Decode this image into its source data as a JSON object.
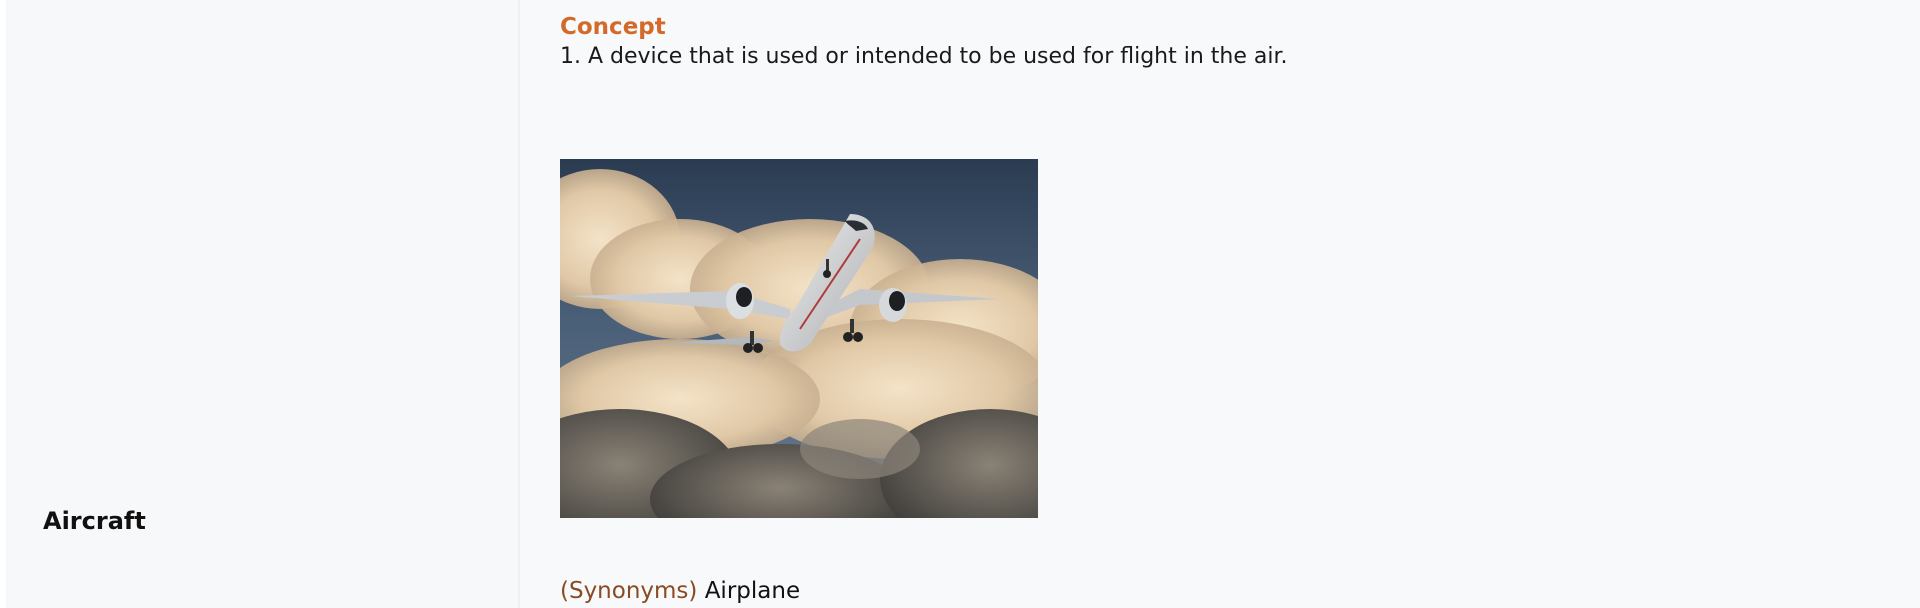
{
  "entry": {
    "term": "Aircraft",
    "concept_label": "Concept",
    "definition": "1. A device that is used or intended to be used for flight in the air.",
    "image": {
      "subject": "airplane-photo"
    },
    "synonyms": {
      "label": "(Synonyms)",
      "value": "Airplane"
    }
  },
  "colors": {
    "concept_label": "#d36a2a",
    "synonyms_label": "#8a4a22",
    "text": "#1a1a1a",
    "background": "#f8f9fb"
  }
}
